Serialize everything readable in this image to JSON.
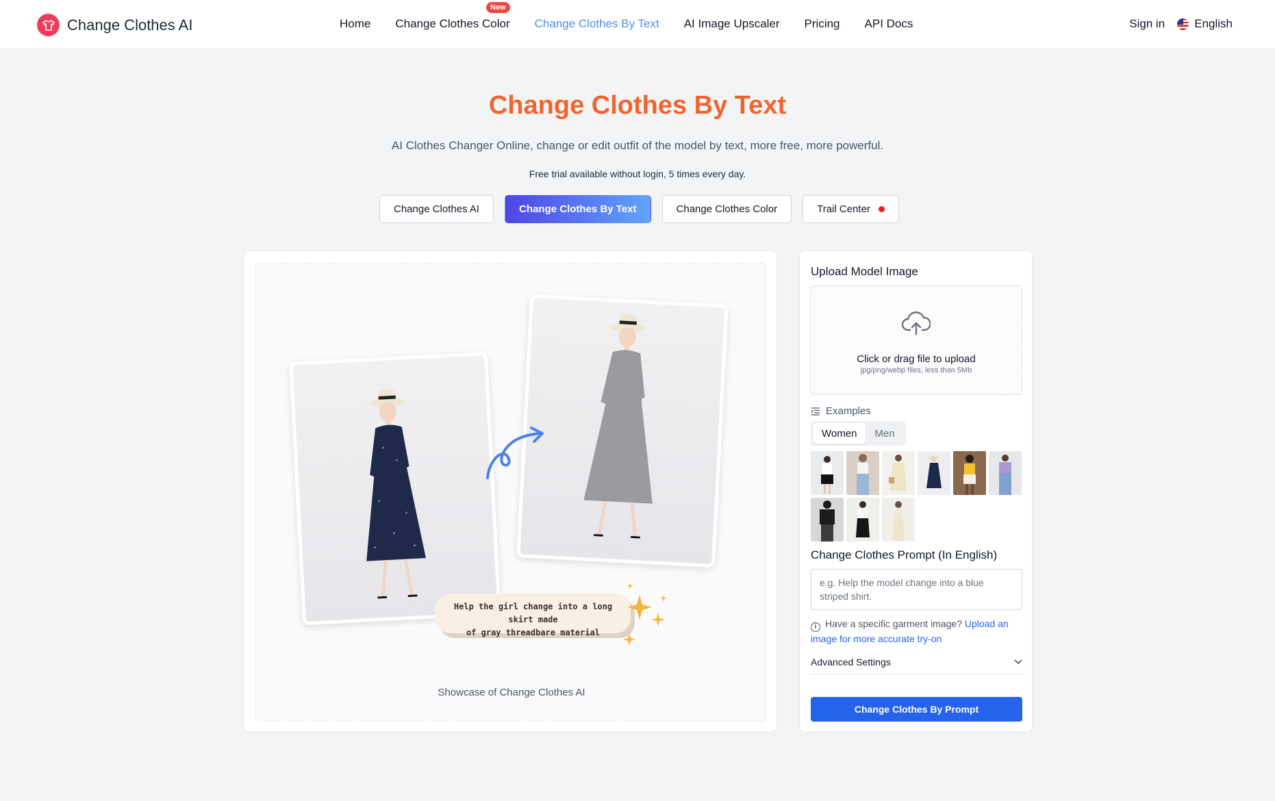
{
  "header": {
    "brand": "Change Clothes AI",
    "nav": [
      {
        "label": "Home"
      },
      {
        "label": "Change Clothes Color",
        "badge": "New"
      },
      {
        "label": "Change Clothes By Text",
        "active": true
      },
      {
        "label": "AI Image Upscaler"
      },
      {
        "label": "Pricing"
      },
      {
        "label": "API Docs"
      }
    ],
    "sign_in": "Sign in",
    "language": "English"
  },
  "hero": {
    "title": "Change Clothes By Text",
    "subtitle": "AI Clothes Changer Online, change or edit outfit of the model by text, more free, more powerful.",
    "trial": "Free trial available without login, 5 times every day."
  },
  "tabs": [
    {
      "label": "Change Clothes AI"
    },
    {
      "label": "Change Clothes By Text",
      "active": true
    },
    {
      "label": "Change Clothes Color"
    },
    {
      "label": "Trail Center",
      "dot": true
    }
  ],
  "showcase": {
    "caption_line1": "Help the girl change into a long skirt made",
    "caption_line2": "of gray threadbare material",
    "label": "Showcase of Change Clothes AI"
  },
  "panel": {
    "upload_title": "Upload Model Image",
    "upload_text": "Click or drag file to upload",
    "upload_hint": "jpg/png/webp files, less than 5Mb",
    "examples_label": "Examples",
    "example_tabs": [
      "Women",
      "Men"
    ],
    "example_count": 9,
    "prompt_title": "Change Clothes Prompt (In English)",
    "prompt_placeholder": "e.g. Help the model change into a blue striped shirt.",
    "hint_prefix": "Have a specific garment image?",
    "hint_link": "Upload an image for more accurate try-on",
    "advanced_label": "Advanced Settings",
    "submit_label": "Change Clothes By Prompt"
  },
  "colors": {
    "accent": "#2563eb",
    "title": "#f0652f",
    "active_nav": "#4b8fe8",
    "badge": "#ef4444"
  }
}
